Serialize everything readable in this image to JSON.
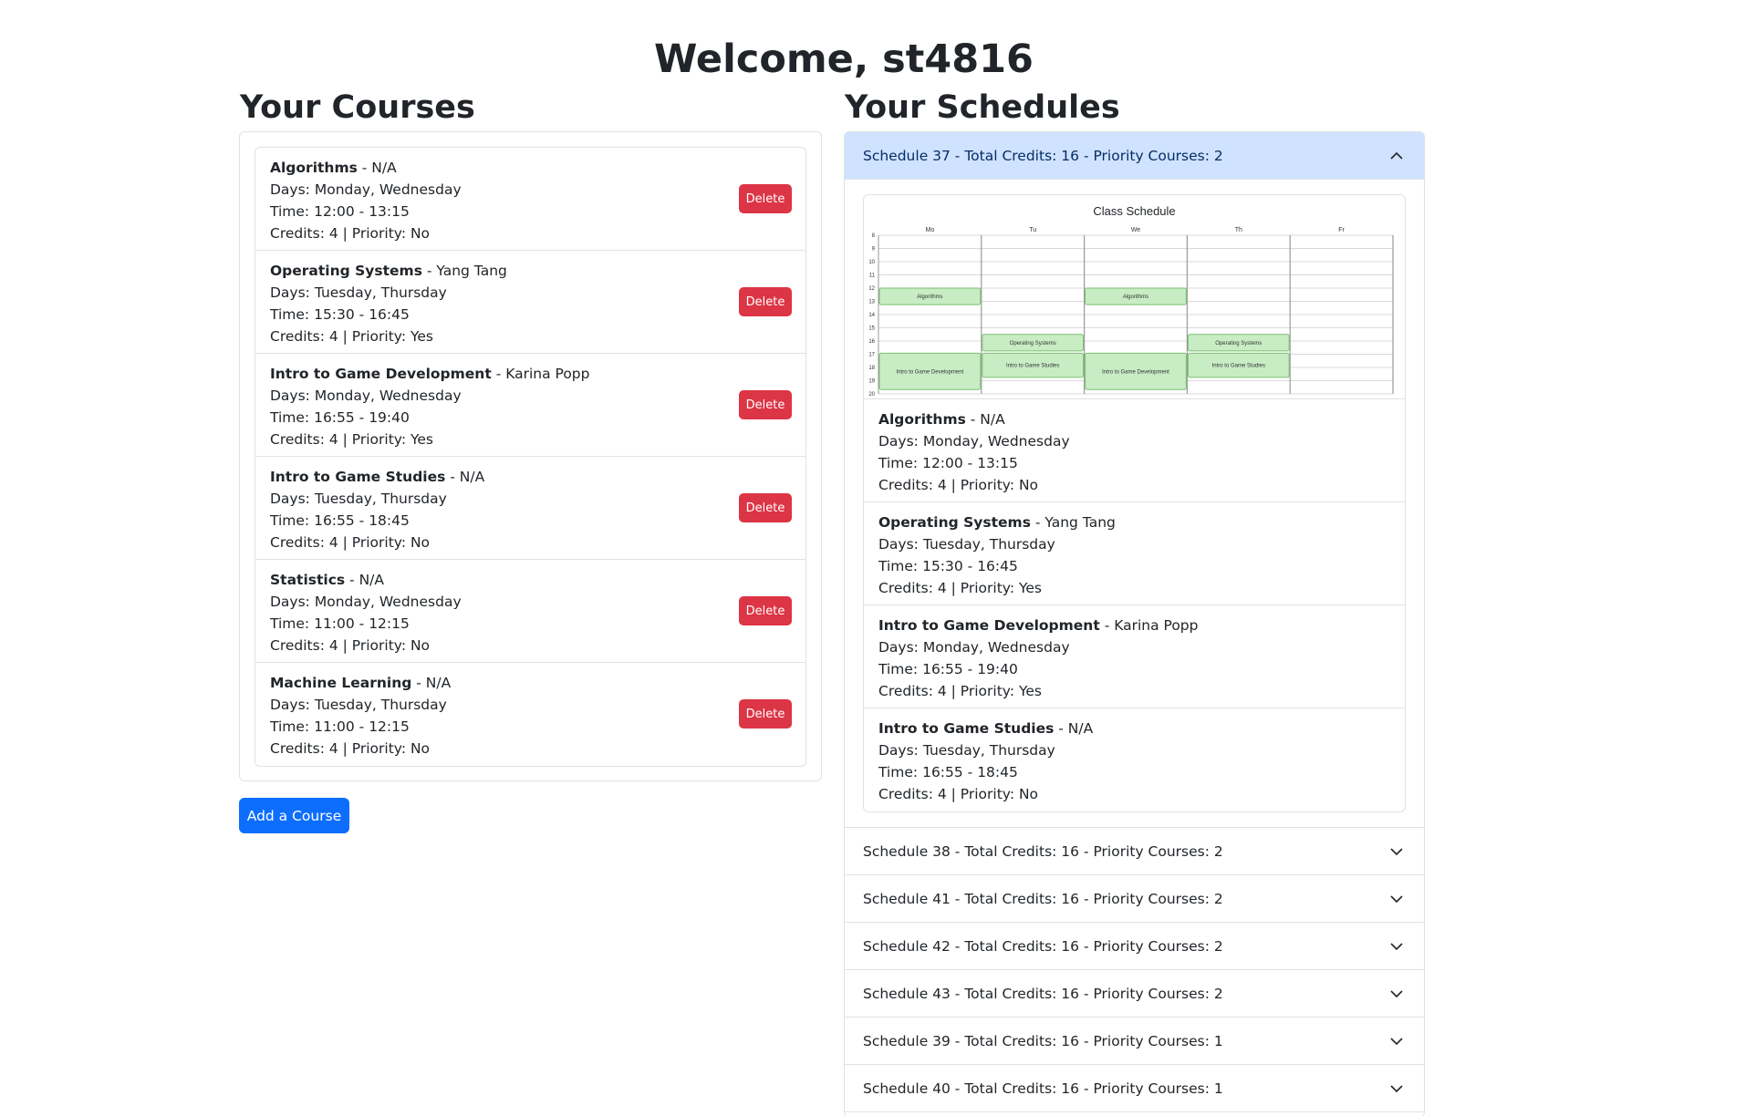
{
  "welcome": "Welcome, st4816",
  "courses_title": "Your Courses",
  "schedules_title": "Your Schedules",
  "add_course_label": "Add a Course",
  "delete_label": "Delete",
  "colors": {
    "primary": "#0d6efd",
    "danger": "#dc3545",
    "accordion_active": "#cfe2ff",
    "calendar_block": "#c8ecc4"
  },
  "courses": [
    {
      "name": "Algorithms",
      "instructor": " - N/A",
      "days": "Days: Monday, Wednesday",
      "time": "Time: 12:00 - 13:15",
      "meta": "Credits: 4 | Priority: No"
    },
    {
      "name": "Operating Systems",
      "instructor": " - Yang Tang",
      "days": "Days: Tuesday, Thursday",
      "time": "Time: 15:30 - 16:45",
      "meta": "Credits: 4 | Priority: Yes"
    },
    {
      "name": "Intro to Game Development",
      "instructor": " - Karina Popp",
      "days": "Days: Monday, Wednesday",
      "time": "Time: 16:55 - 19:40",
      "meta": "Credits: 4 | Priority: Yes"
    },
    {
      "name": "Intro to Game Studies",
      "instructor": " - N/A",
      "days": "Days: Tuesday, Thursday",
      "time": "Time: 16:55 - 18:45",
      "meta": "Credits: 4 | Priority: No"
    },
    {
      "name": "Statistics",
      "instructor": " - N/A",
      "days": "Days: Monday, Wednesday",
      "time": "Time: 11:00 - 12:15",
      "meta": "Credits: 4 | Priority: No"
    },
    {
      "name": "Machine Learning",
      "instructor": " - N/A",
      "days": "Days: Tuesday, Thursday",
      "time": "Time: 11:00 - 12:15",
      "meta": "Credits: 4 | Priority: No"
    }
  ],
  "schedules": [
    {
      "label": "Schedule 37 - Total Credits: 16 - Priority Courses: 2",
      "expanded": true
    },
    {
      "label": "Schedule 38 - Total Credits: 16 - Priority Courses: 2",
      "expanded": false
    },
    {
      "label": "Schedule 41 - Total Credits: 16 - Priority Courses: 2",
      "expanded": false
    },
    {
      "label": "Schedule 42 - Total Credits: 16 - Priority Courses: 2",
      "expanded": false
    },
    {
      "label": "Schedule 43 - Total Credits: 16 - Priority Courses: 2",
      "expanded": false
    },
    {
      "label": "Schedule 39 - Total Credits: 16 - Priority Courses: 1",
      "expanded": false
    },
    {
      "label": "Schedule 40 - Total Credits: 16 - Priority Courses: 1",
      "expanded": false
    }
  ],
  "schedule_37_courses": [
    {
      "name": "Algorithms",
      "instructor": " - N/A",
      "days": "Days: Monday, Wednesday",
      "time": "Time: 12:00 - 13:15",
      "meta": "Credits: 4 | Priority: No"
    },
    {
      "name": "Operating Systems",
      "instructor": " - Yang Tang",
      "days": "Days: Tuesday, Thursday",
      "time": "Time: 15:30 - 16:45",
      "meta": "Credits: 4 | Priority: Yes"
    },
    {
      "name": "Intro to Game Development",
      "instructor": " - Karina Popp",
      "days": "Days: Monday, Wednesday",
      "time": "Time: 16:55 - 19:40",
      "meta": "Credits: 4 | Priority: Yes"
    },
    {
      "name": "Intro to Game Studies",
      "instructor": " - N/A",
      "days": "Days: Tuesday, Thursday",
      "time": "Time: 16:55 - 18:45",
      "meta": "Credits: 4 | Priority: No"
    }
  ],
  "calendar": {
    "title": "Class Schedule",
    "days": [
      "Mo",
      "Tu",
      "We",
      "Th",
      "Fr"
    ],
    "hours": [
      "8",
      "9",
      "10",
      "11",
      "12",
      "13",
      "14",
      "15",
      "16",
      "17",
      "18",
      "19",
      "20"
    ],
    "hour_start": 8,
    "hour_end": 20,
    "blocks": [
      {
        "label": "Algorithms",
        "day": 0,
        "start": 12.0,
        "end": 13.25
      },
      {
        "label": "Algorithms",
        "day": 2,
        "start": 12.0,
        "end": 13.25
      },
      {
        "label": "Operating Systems",
        "day": 1,
        "start": 15.5,
        "end": 16.75
      },
      {
        "label": "Operating Systems",
        "day": 3,
        "start": 15.5,
        "end": 16.75
      },
      {
        "label": "Intro to Game Development",
        "day": 0,
        "start": 16.92,
        "end": 19.67
      },
      {
        "label": "Intro to Game Development",
        "day": 2,
        "start": 16.92,
        "end": 19.67
      },
      {
        "label": "Intro to Game Studies",
        "day": 1,
        "start": 16.92,
        "end": 18.75
      },
      {
        "label": "Intro to Game Studies",
        "day": 3,
        "start": 16.92,
        "end": 18.75
      }
    ]
  }
}
